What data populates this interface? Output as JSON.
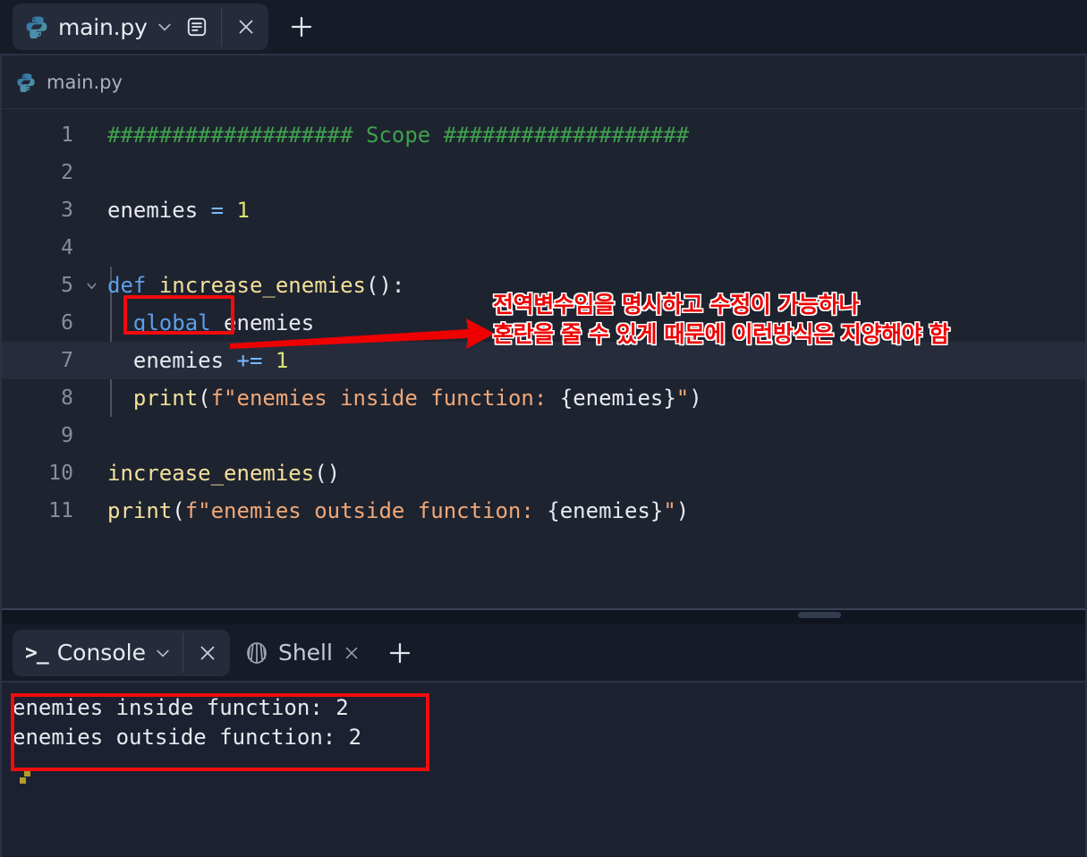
{
  "window": {
    "app": "replit-ide"
  },
  "tabbar": {
    "file_tab": {
      "label": "main.py",
      "icon": "python-icon",
      "chevron": "chevron-down-icon",
      "doc_icon": "document-outline-icon",
      "close": "close-icon"
    },
    "new_tab": "plus-icon"
  },
  "breadcrumb": {
    "icon": "python-icon",
    "label": "main.py"
  },
  "editor": {
    "active_line": 7,
    "lines": [
      {
        "number": "1",
        "foldable": false,
        "tokens": [
          {
            "text": "################### ",
            "cls": "s-comment"
          },
          {
            "text": "Scope",
            "cls": "s-comment"
          },
          {
            "text": " ###################",
            "cls": "s-comment"
          }
        ]
      },
      {
        "number": "2",
        "foldable": false,
        "tokens": []
      },
      {
        "number": "3",
        "foldable": false,
        "tokens": [
          {
            "text": "enemies ",
            "cls": "s-plain"
          },
          {
            "text": "=",
            "cls": "s-op"
          },
          {
            "text": " ",
            "cls": "s-plain"
          },
          {
            "text": "1",
            "cls": "s-num"
          }
        ]
      },
      {
        "number": "4",
        "foldable": false,
        "tokens": []
      },
      {
        "number": "5",
        "foldable": true,
        "tokens": [
          {
            "text": "def",
            "cls": "s-def"
          },
          {
            "text": " ",
            "cls": "s-plain"
          },
          {
            "text": "increase_enemies",
            "cls": "s-fn"
          },
          {
            "text": "():",
            "cls": "s-punct"
          }
        ]
      },
      {
        "number": "6",
        "foldable": false,
        "tokens": [
          {
            "text": "  ",
            "cls": "s-plain"
          },
          {
            "text": "global",
            "cls": "s-kw"
          },
          {
            "text": " enemies",
            "cls": "s-plain"
          }
        ]
      },
      {
        "number": "7",
        "foldable": false,
        "tokens": [
          {
            "text": "  enemies ",
            "cls": "s-plain"
          },
          {
            "text": "+=",
            "cls": "s-op"
          },
          {
            "text": " ",
            "cls": "s-plain"
          },
          {
            "text": "1",
            "cls": "s-num"
          }
        ]
      },
      {
        "number": "8",
        "foldable": false,
        "tokens": [
          {
            "text": "  ",
            "cls": "s-plain"
          },
          {
            "text": "print",
            "cls": "s-fn"
          },
          {
            "text": "(",
            "cls": "s-punct"
          },
          {
            "text": "f\"enemies inside function: ",
            "cls": "s-str"
          },
          {
            "text": "{enemies}",
            "cls": "s-plain"
          },
          {
            "text": "\"",
            "cls": "s-str"
          },
          {
            "text": ")",
            "cls": "s-punct"
          }
        ]
      },
      {
        "number": "9",
        "foldable": false,
        "tokens": []
      },
      {
        "number": "10",
        "foldable": false,
        "tokens": [
          {
            "text": "increase_enemies",
            "cls": "s-fn"
          },
          {
            "text": "()",
            "cls": "s-punct"
          }
        ]
      },
      {
        "number": "11",
        "foldable": false,
        "tokens": [
          {
            "text": "print",
            "cls": "s-fn"
          },
          {
            "text": "(",
            "cls": "s-punct"
          },
          {
            "text": "f\"enemies outside function: ",
            "cls": "s-str"
          },
          {
            "text": "{enemies}",
            "cls": "s-plain"
          },
          {
            "text": "\"",
            "cls": "s-str"
          },
          {
            "text": ")",
            "cls": "s-punct"
          }
        ]
      }
    ]
  },
  "annotations": {
    "highlight_color": "#f00c0c",
    "note_line1": "전역변수임을 명시하고 수정이 가능하나",
    "note_line2": "혼란을 줄 수 있게 때문에 이런방식은 지양해야 함",
    "note_full": "전역변수임을 명시하고 수정이 가능하나\n혼란을 줄 수 있게 때문에 이런방식은 지양해야 함"
  },
  "console": {
    "tabs": [
      {
        "label": "Console",
        "icon": "terminal-prompt-icon",
        "active": true,
        "chevron": "chevron-down-icon",
        "close": "close-icon"
      },
      {
        "label": "Shell",
        "icon": "shell-icon",
        "active": false,
        "close": "close-icon"
      }
    ],
    "new_tab": "plus-icon",
    "output": [
      "enemies inside function: 2",
      "enemies outside function: 2"
    ]
  }
}
